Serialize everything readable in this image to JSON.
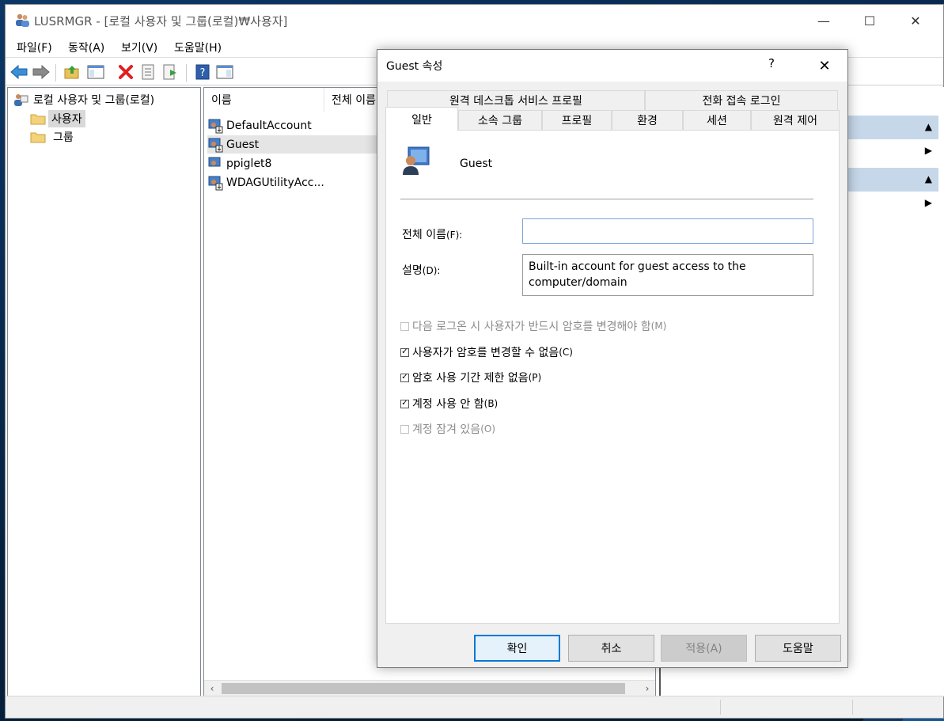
{
  "window": {
    "title": "LUSRMGR - [로컬 사용자 및 그룹(로컬)₩사용자]",
    "minimize_glyph": "—",
    "maximize_glyph": "☐",
    "close_glyph": "✕"
  },
  "menu": [
    "파일(F)",
    "동작(A)",
    "보기(V)",
    "도움말(H)"
  ],
  "toolbar": {
    "icons": [
      "back-icon",
      "forward-icon",
      "up-folder-icon",
      "show-hide-tree-icon",
      "delete-icon",
      "properties-icon",
      "export-list-icon",
      "help-icon",
      "show-hide-action-pane-icon"
    ]
  },
  "tree": {
    "root": "로컬 사용자 및 그룹(로컬)",
    "children": [
      "사용자",
      "그룹"
    ],
    "selected": "사용자"
  },
  "list": {
    "columns": [
      "이름",
      "전체 이름"
    ],
    "rows": [
      "DefaultAccount",
      "Guest",
      "ppiglet8",
      "WDAGUtilityAcc..."
    ],
    "selected": "Guest",
    "scroll_left": "‹",
    "scroll_right": "›"
  },
  "actions": {
    "collapse_glyph": "▲",
    "expand_glyph": "▶"
  },
  "dialog": {
    "title": "Guest 속성",
    "help_glyph": "?",
    "close_glyph": "✕",
    "tabs_back": [
      "원격 데스크톱 서비스 프로필",
      "전화 접속 로그인"
    ],
    "tabs_front": [
      "일반",
      "소속 그룹",
      "프로필",
      "환경",
      "세션",
      "원격 제어"
    ],
    "active_tab": "일반",
    "user_name": "Guest",
    "full_name_label": "전체 이름",
    "full_name_key": "(F):",
    "full_name_value": "",
    "description_label": "설명",
    "description_key": "(D):",
    "description_value": "Built-in account for guest access to the computer/domain",
    "checkboxes": [
      {
        "label": "다음 로그온 시 사용자가 반드시 암호를 변경해야 함",
        "key": "(M)",
        "checked": false,
        "enabled": false
      },
      {
        "label": "사용자가 암호를 변경할 수 없음",
        "key": "(C)",
        "checked": true,
        "enabled": true
      },
      {
        "label": "암호 사용 기간 제한 없음",
        "key": "(P)",
        "checked": true,
        "enabled": true
      },
      {
        "label": "계정 사용 안 함",
        "key": "(B)",
        "checked": true,
        "enabled": true
      },
      {
        "label": "계정 잠겨 있음",
        "key": "(O)",
        "checked": false,
        "enabled": false
      }
    ],
    "buttons": {
      "ok": "확인",
      "cancel": "취소",
      "apply": "적용(A)",
      "help": "도움말"
    }
  }
}
